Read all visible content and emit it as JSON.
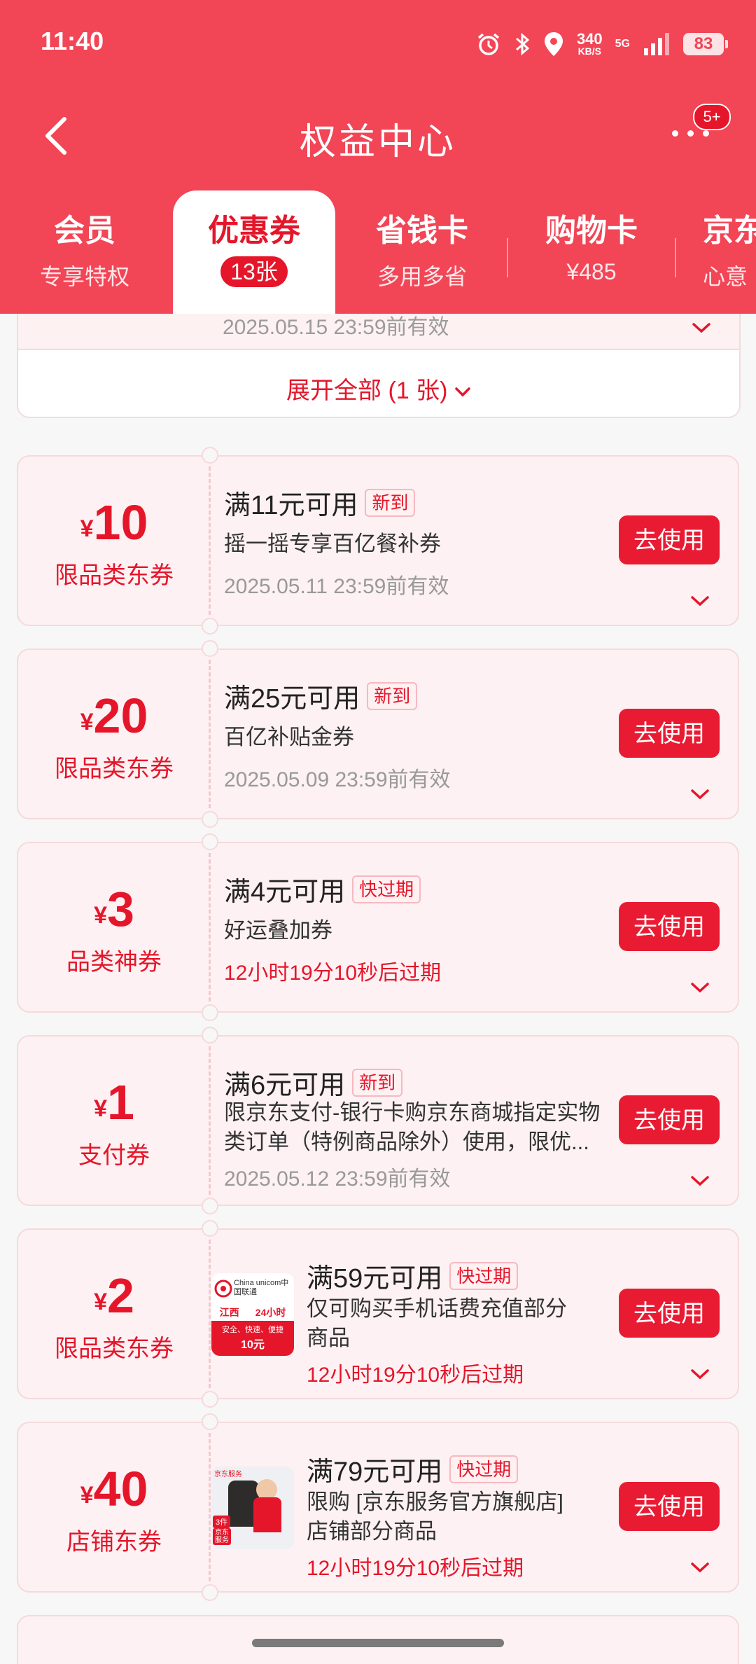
{
  "status_bar": {
    "time": "11:40",
    "net_speed": "340",
    "net_unit": "KB/S",
    "network": "5G",
    "battery": "83"
  },
  "nav": {
    "title": "权益中心",
    "badge": "5+"
  },
  "tabs": [
    {
      "label": "会员",
      "sub": "专享特权"
    },
    {
      "label": "优惠券",
      "sub": "13张"
    },
    {
      "label": "省钱卡",
      "sub": "多用多省"
    },
    {
      "label": "购物卡",
      "sub": "¥485"
    },
    {
      "label": "京东",
      "sub": "心意"
    }
  ],
  "prev_card": {
    "date": "2025.05.15 23:59前有效",
    "expand_label": "展开全部 (1 张)"
  },
  "coupons": [
    {
      "currency": "¥",
      "amount": "10",
      "type": "限品类东券",
      "title": "满11元可用",
      "tag": "新到",
      "desc": "摇一摇专享百亿餐补券",
      "validity": "2025.05.11 23:59前有效",
      "button": "去使用"
    },
    {
      "currency": "¥",
      "amount": "20",
      "type": "限品类东券",
      "title": "满25元可用",
      "tag": "新到",
      "desc": "百亿补贴金券",
      "validity": "2025.05.09 23:59前有效",
      "button": "去使用"
    },
    {
      "currency": "¥",
      "amount": "3",
      "type": "品类神券",
      "title": "满4元可用",
      "tag": "快过期",
      "desc": "好运叠加券",
      "validity": "12小时19分10秒后过期",
      "button": "去使用"
    },
    {
      "currency": "¥",
      "amount": "1",
      "type": "支付券",
      "title": "满6元可用",
      "tag": "新到",
      "desc_line1": "限京东支付-银行卡购京东商城指定实物",
      "desc_line2": "类订单（特例商品除外）使用，限优...",
      "validity": "2025.05.12 23:59前有效",
      "button": "去使用"
    },
    {
      "currency": "¥",
      "amount": "2",
      "type": "限品类东券",
      "title": "满59元可用",
      "tag": "快过期",
      "desc_line1": "仅可购买手机话费充值部分",
      "desc_line2": "商品",
      "validity": "12小时19分10秒后过期",
      "button": "去使用",
      "thumb": {
        "brand": "China unicom中国联通",
        "region": "江西",
        "hours": "24小时",
        "slogan": "安全、快速、便捷",
        "value": "10元"
      }
    },
    {
      "currency": "¥",
      "amount": "40",
      "type": "店铺东券",
      "title": "满79元可用",
      "tag": "快过期",
      "desc_line1": "限购 [京东服务官方旗舰店]",
      "desc_line2": "店铺部分商品",
      "validity": "12小时19分10秒后过期",
      "button": "去使用",
      "thumb": {
        "label": "京东服务",
        "promo1": "3件",
        "promo2": "京东",
        "promo3": "服务"
      }
    }
  ],
  "colors": {
    "brand": "#f24556",
    "accent": "#e5162a",
    "card_bg": "#fdf1f3"
  }
}
